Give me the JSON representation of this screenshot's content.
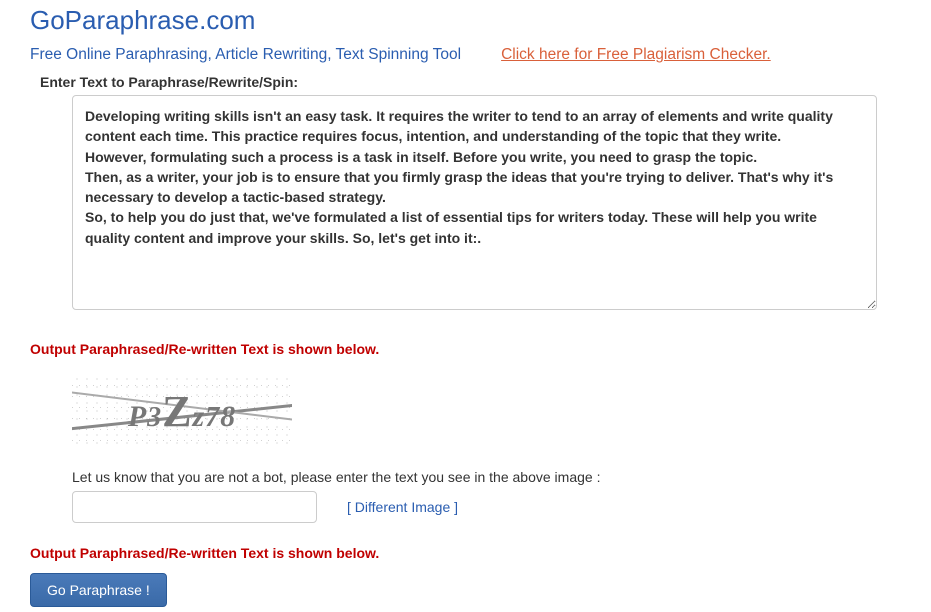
{
  "header": {
    "site_title": "GoParaphrase.com",
    "subtitle": "Free Online Paraphrasing, Article Rewriting, Text Spinning Tool",
    "plagiarism_link_text": "Click here for Free Plagiarism Checker."
  },
  "input": {
    "label": "Enter Text to Paraphrase/Rewrite/Spin:",
    "value": "Developing writing skills isn't an easy task. It requires the writer to tend to an array of elements and write quality content each time. This practice requires focus, intention, and understanding of the topic that they write.\nHowever, formulating such a process is a task in itself. Before you write, you need to grasp the topic.\nThen, as a writer, your job is to ensure that you firmly grasp the ideas that you're trying to deliver. That's why it's necessary to develop a tactic-based strategy.\nSo, to help you do just that, we've formulated a list of essential tips for writers today. These will help you write quality content and improve your skills. So, let's get into it:."
  },
  "output_heading_1": "Output Paraphrased/Re-written Text is shown below.",
  "captcha": {
    "text": "P3Zz78",
    "instruction": "Let us know that you are not a bot, please enter the text you see in the above image :",
    "input_value": "",
    "different_image_label": "[ Different Image ]"
  },
  "output_heading_2": "Output Paraphrased/Re-written Text is shown below.",
  "go_button_label": "Go Paraphrase !"
}
